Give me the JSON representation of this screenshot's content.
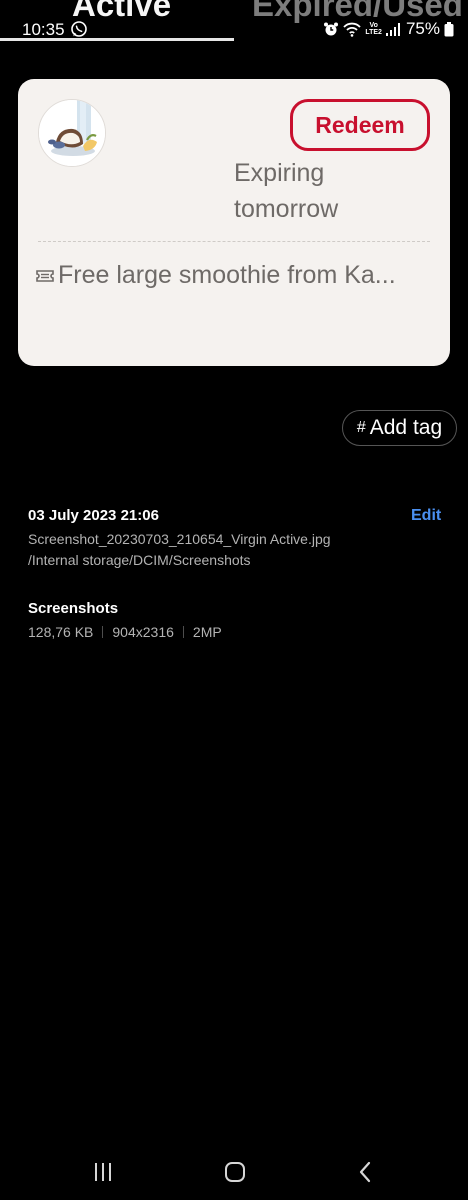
{
  "tabs": [
    {
      "label": "Active",
      "selected": true
    },
    {
      "label": "Expired/Used",
      "selected": false
    }
  ],
  "status_bar": {
    "time": "10:35",
    "battery": "75%",
    "network": "LTE2",
    "network_prefix": "Vo",
    "icons": [
      "whatsapp-icon",
      "alarm-icon",
      "wifi-icon",
      "signal-icon",
      "battery-icon"
    ]
  },
  "voucher": {
    "redeem_label": "Redeem",
    "expiry": "Expiring tomorrow",
    "offer": "Free large smoothie from Ka...",
    "image_icon": "coconut-smoothie-image",
    "offer_icon": "ticket-icon"
  },
  "tag": {
    "add_label": "Add tag",
    "icon": "#"
  },
  "details": {
    "date": "03 July 2023 21:06",
    "edit_label": "Edit",
    "file_name": "Screenshot_20230703_210654_Virgin Active.jpg",
    "path": "/Internal storage/DCIM/Screenshots",
    "album": "Screenshots",
    "size": "128,76 KB",
    "dimensions": "904x2316",
    "megapixels": "2MP"
  },
  "nav_bar": [
    "recents-icon",
    "home-icon",
    "back-icon"
  ],
  "colors": {
    "background": "#000000",
    "card": "#f5f2ef",
    "redeem_accent": "#c8102e",
    "edit_link": "#4a8ff0"
  }
}
